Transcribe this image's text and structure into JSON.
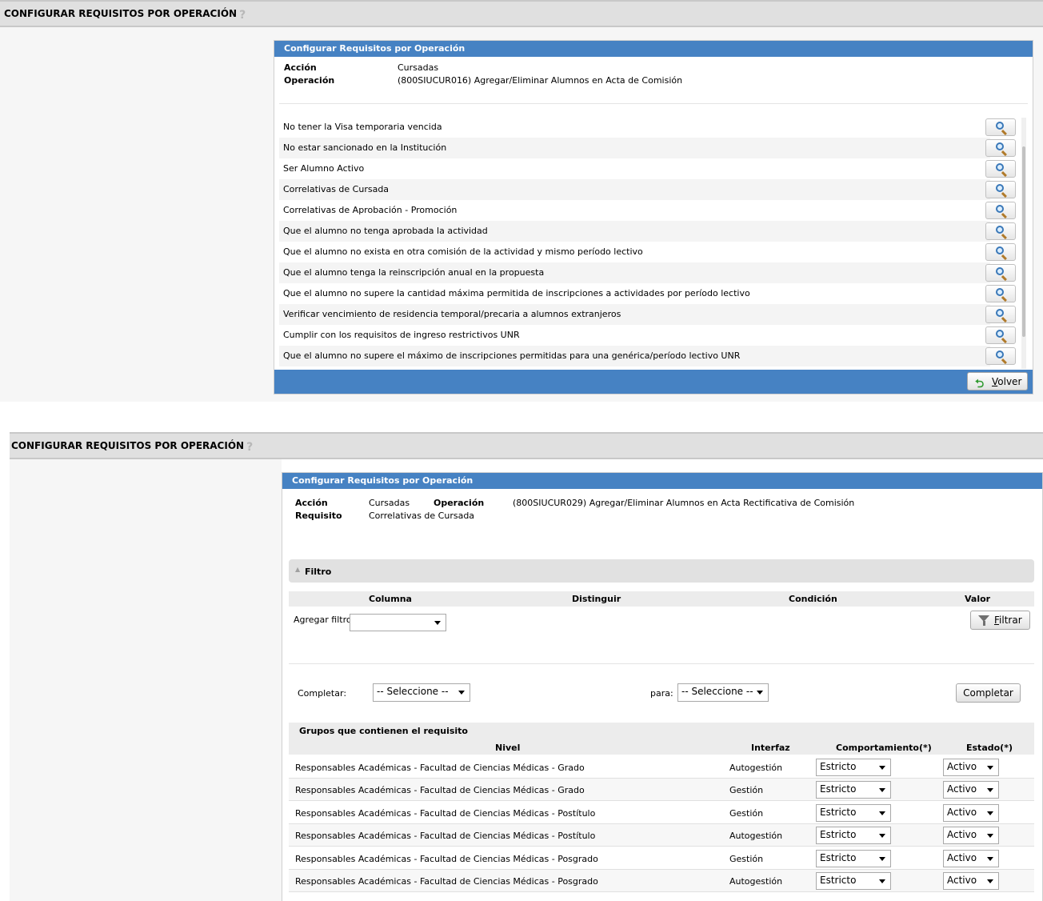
{
  "screen1": {
    "page_title": "CONFIGURAR REQUISITOS POR OPERACIÓN",
    "help": "?",
    "panel_title": "Configurar Requisitos por Operación",
    "accion_label": "Acción",
    "accion_value": "Cursadas",
    "operacion_label": "Operación",
    "operacion_value": "(800SIUCUR016) Agregar/Eliminar Alumnos en Acta de Comisión",
    "requisitos": [
      "No tener la Visa temporaria vencida",
      "No estar sancionado en la Institución",
      "Ser Alumno Activo",
      "Correlativas de Cursada",
      "Correlativas de Aprobación - Promoción",
      "Que el alumno no tenga aprobada la actividad",
      "Que el alumno no exista en otra comisión de la actividad y mismo período lectivo",
      "Que el alumno tenga la reinscripción anual en la propuesta",
      "Que el alumno no supere la cantidad máxima permitida de inscripciones a actividades por período lectivo",
      "Verificar vencimiento de residencia temporal/precaria a alumnos extranjeros",
      "Cumplir con los requisitos de ingreso restrictivos UNR",
      "Que el alumno no supere el máximo de inscripciones permitidas para una genérica/período lectivo UNR"
    ],
    "volver_accel": "V",
    "volver_rest": "olver"
  },
  "screen2": {
    "page_title": "CONFIGURAR REQUISITOS POR OPERACIÓN",
    "help": "?",
    "panel_title": "Configurar Requisitos por Operación",
    "accion_label": "Acción",
    "accion_value": "Cursadas",
    "operacion_label": "Operación",
    "operacion_value": "(800SIUCUR029) Agregar/Eliminar Alumnos en Acta Rectificativa de Comisión",
    "requisito_label": "Requisito",
    "requisito_value": "Correlativas de Cursada",
    "filtro_title": "Filtro",
    "filter_cols": {
      "columna": "Columna",
      "distinguir": "Distinguir",
      "condicion": "Condición",
      "valor": "Valor"
    },
    "agregar_filtro_label": "Agregar filtro",
    "agregar_filtro_value": "",
    "filtrar_accel": "F",
    "filtrar_rest": "iltrar",
    "completar_label": "Completar:",
    "completar_value": "-- Seleccione --",
    "para_label": "para:",
    "para_value": "-- Seleccione --",
    "completar_button": "Completar",
    "grupos_title": "Grupos que contienen el requisito",
    "grupos_cols": {
      "nivel": "Nivel",
      "interfaz": "Interfaz",
      "comportamiento": "Comportamiento(*)",
      "estado": "Estado(*)"
    },
    "grupos": [
      {
        "nivel": "Responsables Académicas - Facultad de Ciencias Médicas - Grado",
        "interfaz": "Autogestión",
        "comportamiento": "Estricto",
        "estado": "Activo"
      },
      {
        "nivel": "Responsables Académicas - Facultad de Ciencias Médicas - Grado",
        "interfaz": "Gestión",
        "comportamiento": "Estricto",
        "estado": "Activo"
      },
      {
        "nivel": "Responsables Académicas - Facultad de Ciencias Médicas - Postítulo",
        "interfaz": "Gestión",
        "comportamiento": "Estricto",
        "estado": "Activo"
      },
      {
        "nivel": "Responsables Académicas - Facultad de Ciencias Médicas - Postítulo",
        "interfaz": "Autogestión",
        "comportamiento": "Estricto",
        "estado": "Activo"
      },
      {
        "nivel": "Responsables Académicas - Facultad de Ciencias Médicas - Posgrado",
        "interfaz": "Gestión",
        "comportamiento": "Estricto",
        "estado": "Activo"
      },
      {
        "nivel": "Responsables Académicas - Facultad de Ciencias Médicas - Posgrado",
        "interfaz": "Autogestión",
        "comportamiento": "Estricto",
        "estado": "Activo"
      }
    ]
  }
}
